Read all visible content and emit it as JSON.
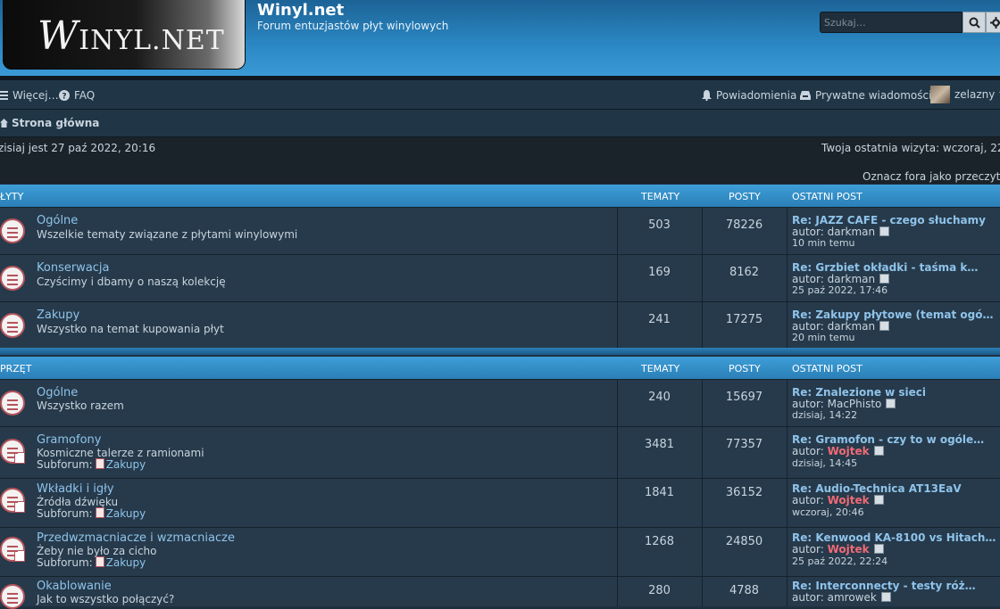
{
  "header": {
    "logo_prefix": "W",
    "logo_rest": "INYL.NET",
    "site_title": "Winyl.net",
    "site_desc": "Forum entuzjastów płyt winylowych",
    "search_placeholder": "Szukaj…"
  },
  "nav": {
    "more": "Więcej…",
    "faq": "FAQ",
    "notifications": "Powiadomienia",
    "messages": "Prywatne wiadomości",
    "user": "zelazny"
  },
  "breadcrumb": {
    "home": "Strona główna"
  },
  "info": {
    "date_left": "zisiaj jest 27 paź 2022, 20:16",
    "last_visit": "Twoja ostatnia wizyta: wczoraj, 22:",
    "mark_read": "Oznacz fora jako przeczyta"
  },
  "categories": [
    {
      "name": "ŁYTY",
      "col_topics": "TEMATY",
      "col_posts": "POSTY",
      "col_last": "OSTATNI POST",
      "forums": [
        {
          "title": "Ogólne",
          "desc": "Wszelkie tematy związane z płytami winylowymi",
          "topics": "503",
          "posts": "78226",
          "last_title": "Re: JAZZ CAFE - czego słuchamy",
          "author_label": "autor:",
          "author": "darkman",
          "author_red": false,
          "time": "10 min temu"
        },
        {
          "title": "Konserwacja",
          "desc": "Czyścimy i dbamy o naszą kolekcję",
          "topics": "169",
          "posts": "8162",
          "last_title": "Re: Grzbiet okładki - taśma k…",
          "author_label": "autor:",
          "author": "darkman",
          "author_red": false,
          "time": "25 paź 2022, 17:46"
        },
        {
          "title": "Zakupy",
          "desc": "Wszystko na temat kupowania płyt",
          "topics": "241",
          "posts": "17275",
          "last_title": "Re: Zakupy płytowe (temat ogó…",
          "author_label": "autor:",
          "author": "darkman",
          "author_red": false,
          "time": "20 min temu"
        }
      ]
    },
    {
      "name": "PRZĘT",
      "col_topics": "TEMATY",
      "col_posts": "POSTY",
      "col_last": "OSTATNI POST",
      "forums": [
        {
          "title": "Ogólne",
          "desc": "Wszystko razem",
          "topics": "240",
          "posts": "15697",
          "last_title": "Re: Znalezione w sieci",
          "author_label": "autor:",
          "author": "MacPhisto",
          "author_red": false,
          "time": "dzisiaj, 14:22"
        },
        {
          "title": "Gramofony",
          "desc": "Kosmiczne talerze z ramionami",
          "sub_label": "Subforum:",
          "sub": "Zakupy",
          "topics": "3481",
          "posts": "77357",
          "last_title": "Re: Gramofon - czy to w ogóle…",
          "author_label": "autor:",
          "author": "Wojtek",
          "author_red": true,
          "time": "dzisiaj, 14:45"
        },
        {
          "title": "Wkładki i igły",
          "desc": "Źródła dźwięku",
          "sub_label": "Subforum:",
          "sub": "Zakupy",
          "topics": "1841",
          "posts": "36152",
          "last_title": "Re: Audio-Technica AT13EaV",
          "author_label": "autor:",
          "author": "Wojtek",
          "author_red": true,
          "time": "wczoraj, 20:46"
        },
        {
          "title": "Przedwzmacniacze i wzmacniacze",
          "desc": "Żeby nie było za cicho",
          "sub_label": "Subforum:",
          "sub": "Zakupy",
          "topics": "1268",
          "posts": "24850",
          "last_title": "Re: Kenwood KA-8100 vs Hitach…",
          "author_label": "autor:",
          "author": "Wojtek",
          "author_red": true,
          "time": "25 paź 2022, 22:24"
        },
        {
          "title": "Okablowanie",
          "desc": "Jak to wszystko połączyć?",
          "topics": "280",
          "posts": "4788",
          "last_title": "Re: Interconnecty - testy róż…",
          "author_label": "autor:",
          "author": "amrowek",
          "author_red": false,
          "time": ""
        }
      ]
    }
  ],
  "icons": {
    "menu": "menu-icon",
    "faq": "question-icon",
    "bell": "bell-icon",
    "inbox": "inbox-icon",
    "home": "home-icon",
    "search": "search-icon",
    "gear": "gear-icon",
    "forum": "forum-read-icon",
    "goto": "goto-post-icon"
  },
  "colors": {
    "accent": "#2b88c4",
    "link": "#8fc3ea",
    "moderator": "#f06a76"
  }
}
